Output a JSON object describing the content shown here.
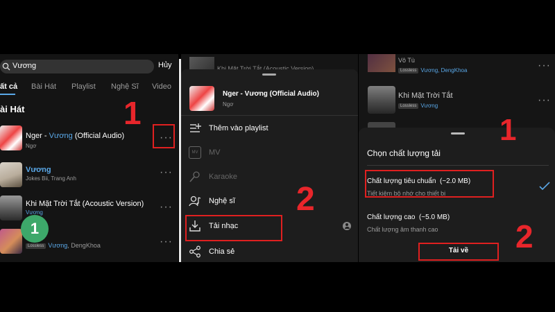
{
  "panel1": {
    "search_value": "Vương",
    "cancel_label": "Hủy",
    "tabs": [
      "ất cả",
      "Bài Hát",
      "Playlist",
      "Nghệ Sĩ",
      "Video"
    ],
    "section_title": "ài Hát",
    "songs": [
      {
        "title_a": "Nger - ",
        "title_b": "Vương",
        "title_c": " (Official Audio)",
        "artist": "Ngơ"
      },
      {
        "title": "Vương",
        "artist": "Jokes Bii, Trang Anh"
      },
      {
        "title": "Khi Mặt Trời Tắt (Acoustic Version)",
        "artist": "Vương"
      },
      {
        "badge": "Lossless",
        "artist_a": "Vương",
        "artist_b": ", DengKhoa"
      }
    ],
    "circle_number": "1",
    "big_number": "1"
  },
  "panel2": {
    "top_song": "Khi Mặt Trời Tắt (Acoustic Version)",
    "song_title": "Nger - Vương (Official Audio)",
    "song_artist": "Ngơ",
    "menu": [
      "Thêm vào playlist",
      "MV",
      "Karaoke",
      "Nghệ sĩ",
      "Tải nhạc",
      "Chia sẻ"
    ],
    "big_number": "2"
  },
  "panel3": {
    "bg_songs": [
      {
        "title": "Vô Tù",
        "badge": "Lossless",
        "artist": "Vương, DengKhoa"
      },
      {
        "title": "Khi Mặt Trời Tắt",
        "badge": "Lossless",
        "artist": "Vương"
      }
    ],
    "sheet_title": "Chọn chất lượng tải",
    "options": [
      {
        "label": "Chất lượng tiêu chuẩn",
        "size": "(~2.0 MB)",
        "desc": "Tiết kiệm bộ nhớ cho thiết bị"
      },
      {
        "label": "Chất lượng cao",
        "size": "(~5.0 MB)",
        "desc": "Chất lượng âm thanh cao"
      }
    ],
    "download_label": "Tải về",
    "big_number_1": "1",
    "big_number_2": "2"
  },
  "colors": {
    "accent_blue": "#5aa8e8",
    "annotation_red": "#e02020"
  }
}
